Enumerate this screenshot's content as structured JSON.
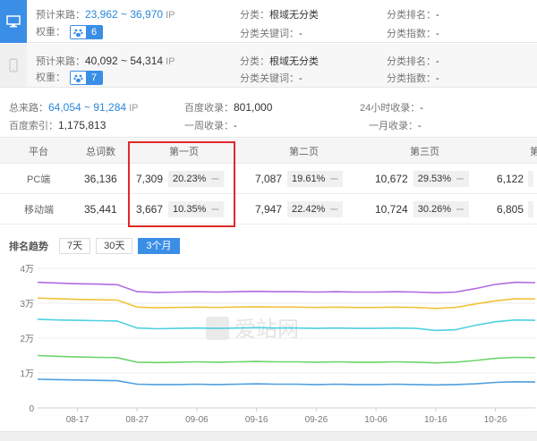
{
  "pc": {
    "icon": "monitor-icon",
    "traffic_label": "预计来路：",
    "traffic_value": "23,962 ~ 36,970",
    "traffic_unit": "IP",
    "weight_label": "权重：",
    "weight_value": "6",
    "category_label": "分类：",
    "category_value": "根域无分类",
    "category_keyword_label": "分类关键词：",
    "category_keyword_value": "-",
    "category_rank_label": "分类排名：",
    "category_rank_value": "-",
    "category_index_label": "分类指数：",
    "category_index_value": "-"
  },
  "mobile": {
    "icon": "mobile-phone-icon",
    "traffic_label": "预计来路：",
    "traffic_value": "40,092 ~ 54,314",
    "traffic_unit": "IP",
    "weight_label": "权重：",
    "weight_value": "7",
    "category_label": "分类：",
    "category_value": "根域无分类",
    "category_keyword_label": "分类关键词：",
    "category_keyword_value": "-",
    "category_rank_label": "分类排名：",
    "category_rank_value": "-",
    "category_index_label": "分类指数：",
    "category_index_value": "-"
  },
  "summary": {
    "total_traffic_label": "总来路：",
    "total_traffic_value": "64,054 ~ 91,284",
    "total_traffic_unit": "IP",
    "baidu_index_label": "百度收录：",
    "baidu_index_value": "801,000",
    "day_index_label": "24小时收录：",
    "day_index_value": "-",
    "baidu_pages_label": "百度索引：",
    "baidu_pages_value": "1,175,813",
    "week_index_label": "一周收录：",
    "week_index_value": "-",
    "month_index_label": "一月收录：",
    "month_index_value": "-"
  },
  "rank_table": {
    "headers": [
      "平台",
      "总词数",
      "第一页",
      "第二页",
      "第三页",
      "第"
    ],
    "rows": [
      {
        "platform": "PC端",
        "total": "36,136",
        "p1": "7,309",
        "p1_pct": "20.23%",
        "p2": "7,087",
        "p2_pct": "19.61%",
        "p3": "10,672",
        "p3_pct": "29.53%",
        "p4": "6,122"
      },
      {
        "platform": "移动端",
        "total": "35,441",
        "p1": "3,667",
        "p1_pct": "10.35%",
        "p2": "7,947",
        "p2_pct": "22.42%",
        "p3": "10,724",
        "p3_pct": "30.26%",
        "p4": "6,805"
      }
    ],
    "trend_arrow": "ー"
  },
  "trend": {
    "title": "排名趋势",
    "buttons": [
      "7天",
      "30天",
      "3个月"
    ],
    "active_index": 2
  },
  "watermark": "爱站网",
  "chart_data": {
    "type": "line",
    "x": [
      "08-10",
      "08-13",
      "08-17",
      "08-20",
      "08-23",
      "08-27",
      "08-30",
      "09-02",
      "09-06",
      "09-09",
      "09-12",
      "09-16",
      "09-19",
      "09-22",
      "09-26",
      "09-29",
      "10-02",
      "10-06",
      "10-09",
      "10-12",
      "10-16",
      "10-19",
      "10-22",
      "10-26",
      "10-29",
      "11-02"
    ],
    "xticks": [
      "08-17",
      "08-27",
      "09-06",
      "09-16",
      "09-26",
      "10-06",
      "10-16",
      "10-26"
    ],
    "yticks": [
      "0",
      "1万",
      "2万",
      "3万",
      "4万"
    ],
    "ylim": [
      0,
      40000
    ],
    "grid": true,
    "series": [
      {
        "color": "#b26be0",
        "values": [
          36000,
          35800,
          35600,
          35500,
          35300,
          33300,
          33100,
          33200,
          33300,
          33200,
          33300,
          33400,
          33300,
          33300,
          33200,
          33300,
          33200,
          33200,
          33300,
          33200,
          33000,
          33200,
          34200,
          35400,
          36000,
          35900
        ]
      },
      {
        "color": "#f2c23a",
        "values": [
          31500,
          31300,
          31100,
          31000,
          30900,
          28900,
          28700,
          28800,
          28900,
          28800,
          28900,
          29000,
          28900,
          28900,
          28800,
          28900,
          28800,
          28800,
          28900,
          28800,
          28500,
          28800,
          29800,
          30700,
          31300,
          31200
        ]
      },
      {
        "color": "#4fd0e0",
        "values": [
          25400,
          25200,
          25100,
          25000,
          24900,
          22900,
          22700,
          22800,
          22900,
          22800,
          22900,
          23000,
          22900,
          22900,
          22800,
          22900,
          22800,
          22800,
          22900,
          22800,
          22200,
          22400,
          23700,
          24700,
          25200,
          25100
        ]
      },
      {
        "color": "#6cd56a",
        "values": [
          15000,
          14800,
          14600,
          14500,
          14400,
          13100,
          13000,
          13100,
          13200,
          13100,
          13200,
          13300,
          13200,
          13200,
          13100,
          13200,
          13100,
          13100,
          13200,
          13100,
          12900,
          13100,
          13600,
          14200,
          14500,
          14400
        ]
      },
      {
        "color": "#4f9fe0",
        "values": [
          8200,
          8100,
          8000,
          7900,
          7800,
          6800,
          6700,
          6700,
          6800,
          6700,
          6800,
          6900,
          6800,
          6800,
          6700,
          6800,
          6700,
          6700,
          6800,
          6700,
          6600,
          6700,
          6900,
          7300,
          7500,
          7400
        ]
      }
    ]
  }
}
